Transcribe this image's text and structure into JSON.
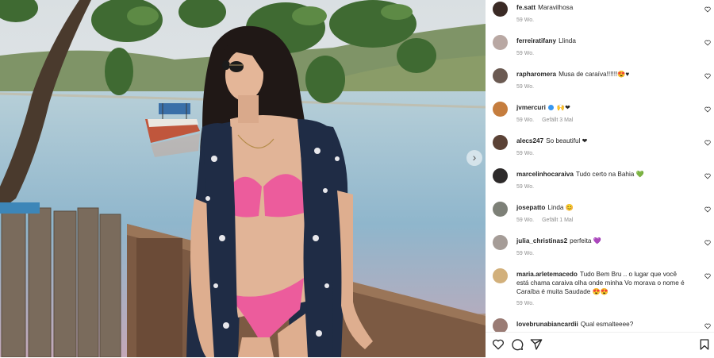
{
  "comments": [
    {
      "username": "fe.satt",
      "text": "Maravilhosa",
      "time": "59 Wo.",
      "likes": "",
      "avatar_color": "#3a2a25"
    },
    {
      "username": "ferreiratifany",
      "text": "Llinda",
      "time": "59 Wo.",
      "likes": "",
      "avatar_color": "#b9a8a3"
    },
    {
      "username": "rapharomera",
      "text": "Musa de caraíva!!!!!!😍♥",
      "time": "59 Wo.",
      "likes": "",
      "avatar_color": "#6b5a52"
    },
    {
      "username": "jvmercuri",
      "text": "🙌❤",
      "time": "59 Wo.",
      "likes": "Gefällt 3 Mal",
      "avatar_color": "#c57d3e"
    },
    {
      "username": "alecs247",
      "text": "So beautiful ❤",
      "time": "59 Wo.",
      "likes": "",
      "avatar_color": "#5b4236"
    },
    {
      "username": "marcelinhocaraiva",
      "text": "Tudo certo na Bahia 💚",
      "time": "59 Wo.",
      "likes": "",
      "avatar_color": "#2d2a2a"
    },
    {
      "username": "josepatto",
      "text": "Linda 😊",
      "time": "59 Wo.",
      "likes": "Gefällt 1 Mal",
      "avatar_color": "#7d8077"
    },
    {
      "username": "julia_christinas2",
      "text": "perfeita 💜",
      "time": "59 Wo.",
      "likes": "",
      "avatar_color": "#a59c97"
    },
    {
      "username": "maria.arletemacedo",
      "text": "Tudo Bem Bru .. o lugar que você está chama caraiva olha onde minha Vo morava o nome é Caraíba é muita Saudade 😍😍",
      "time": "59 Wo.",
      "likes": "",
      "avatar_color": "#d2b07b"
    },
    {
      "username": "lovebrunabiancardii",
      "text": "Qual esmalteeee?",
      "time": "",
      "likes": "",
      "avatar_color": "#9a7b74"
    }
  ],
  "icons": {
    "like": "heart-outline-icon",
    "comment": "comment-bubble-icon",
    "share": "paper-plane-icon",
    "save": "bookmark-icon",
    "next": "chevron-right-icon",
    "verified": "verified-badge-icon"
  },
  "next_glyph": "›"
}
